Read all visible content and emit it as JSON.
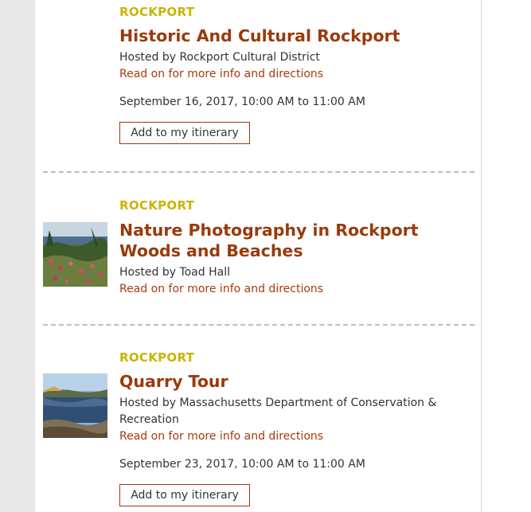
{
  "events": [
    {
      "location": "ROCKPORT",
      "title": "Historic And Cultural Rockport",
      "host": "Hosted by Rockport Cultural District",
      "more_link": "Read on for more info and directions",
      "date": "September 16, 2017, 10:00 AM to 11:00 AM",
      "button": "Add to my itinerary"
    },
    {
      "location": "ROCKPORT",
      "title": "Nature Photography in Rockport Woods and Beaches",
      "host": "Hosted by Toad Hall",
      "more_link": "Read on for more info and directions",
      "thumbnail": "coastal-wildflowers-photo"
    },
    {
      "location": "ROCKPORT",
      "title": "Quarry Tour",
      "host": "Hosted by Massachusetts Department of Conservation & Recreation",
      "more_link": "Read on for more info and directions",
      "date": "September 23, 2017, 10:00 AM to 11:00 AM",
      "button": "Add to my itinerary",
      "thumbnail": "quarry-pond-photo"
    }
  ],
  "colors": {
    "location": "#c9b400",
    "title": "#9a3a0b",
    "link": "#a83a0e",
    "button_border": "#9a3a0b"
  }
}
